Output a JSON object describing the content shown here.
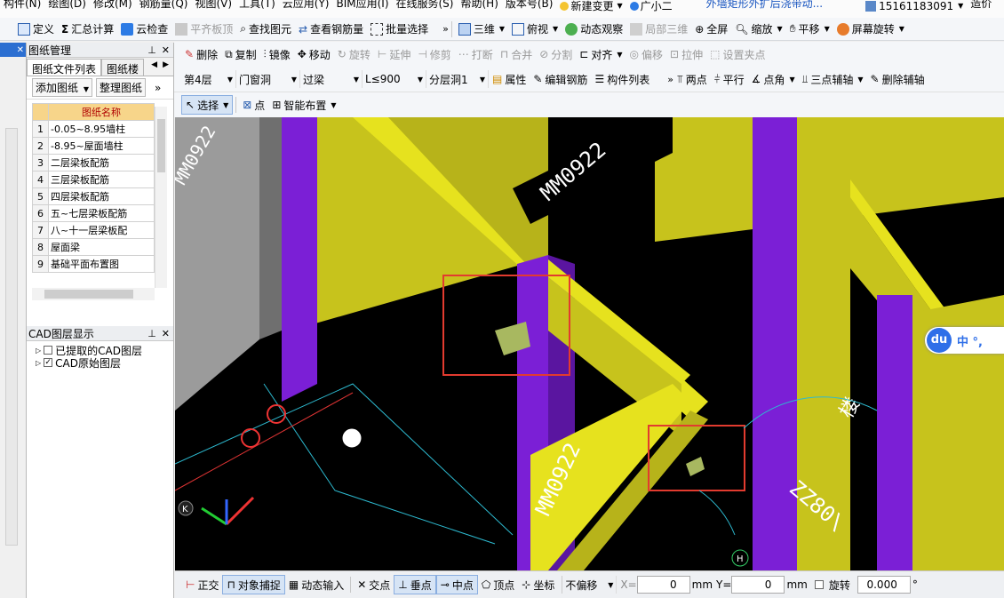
{
  "menubar": {
    "items": [
      "构件(N)",
      "绘图(D)",
      "修改(M)",
      "钢筋量(Q)",
      "视图(V)",
      "工具(T)",
      "云应用(Y)",
      "BIM应用(I)",
      "在线服务(S)",
      "帮助(H)",
      "版本号(B)",
      "新建变更",
      "广小二"
    ],
    "notice": "外墙矩形外扩后浇带动...",
    "phone": "15161183091",
    "extra": "造价"
  },
  "toolbar1": {
    "items": [
      "定义",
      "汇总计算",
      "云检查",
      "平齐板顶",
      "查找图元",
      "查看钢筋量",
      "批量选择"
    ],
    "right": [
      "三维",
      "俯视",
      "动态观察",
      "局部三维",
      "全屏",
      "缩放",
      "平移",
      "屏幕旋转"
    ]
  },
  "panel": {
    "title": "图纸管理",
    "tabs": [
      "图纸文件列表",
      "图纸楼"
    ],
    "buttons": [
      "添加图纸",
      "整理图纸"
    ],
    "column": "图纸名称",
    "rows": [
      {
        "n": "1",
        "name": "-0.05~8.95墙柱"
      },
      {
        "n": "2",
        "name": "-8.95~屋面墙柱"
      },
      {
        "n": "3",
        "name": "二层梁板配筋"
      },
      {
        "n": "4",
        "name": "三层梁板配筋"
      },
      {
        "n": "5",
        "name": "四层梁板配筋"
      },
      {
        "n": "6",
        "name": "五~七层梁板配筋"
      },
      {
        "n": "7",
        "name": "八~十一层梁板配"
      },
      {
        "n": "8",
        "name": "屋面梁"
      },
      {
        "n": "9",
        "name": "基础平面布置图"
      }
    ],
    "cad_title": "CAD图层显示",
    "layers": [
      {
        "label": "已提取的CAD图层",
        "checked": ""
      },
      {
        "label": "CAD原始图层",
        "checked": "✓"
      }
    ]
  },
  "toolbar2": {
    "items": [
      "删除",
      "复制",
      "镜像",
      "移动",
      "旋转",
      "延伸",
      "修剪",
      "打断",
      "合并",
      "分割",
      "对齐",
      "偏移",
      "拉伸",
      "设置夹点"
    ]
  },
  "toolbar3": {
    "combos": [
      "第4层",
      "门窗洞",
      "过梁",
      "L≤900",
      "分层洞1"
    ],
    "items": [
      "属性",
      "编辑钢筋",
      "构件列表"
    ],
    "right": [
      "两点",
      "平行",
      "点角",
      "三点辅轴",
      "删除辅轴"
    ]
  },
  "toolbar4": {
    "items": [
      "选择",
      "点",
      "智能布置"
    ]
  },
  "viewport": {
    "labels": [
      "MM0922",
      "MM0922",
      "ZZ80\\",
      "MM0922",
      "楼"
    ],
    "axis": "K",
    "axis2": "H"
  },
  "ime": {
    "logo": "du",
    "text": "中 °,"
  },
  "statusbar": {
    "items": [
      "正交",
      "对象捕捉",
      "动态输入",
      "交点",
      "垂点",
      "中点",
      "顶点",
      "坐标"
    ],
    "offset": "不偏移",
    "x_label": "X=",
    "x_value": "0",
    "y_label": "Y=",
    "y_value": "0",
    "unit": "mm",
    "rotate_label": "旋转",
    "rotate_value": "0.000",
    "deg": "°"
  },
  "colors": {
    "beam": "#c7c31c",
    "column": "#7b1fd6",
    "highlight": "#e23b2f"
  }
}
